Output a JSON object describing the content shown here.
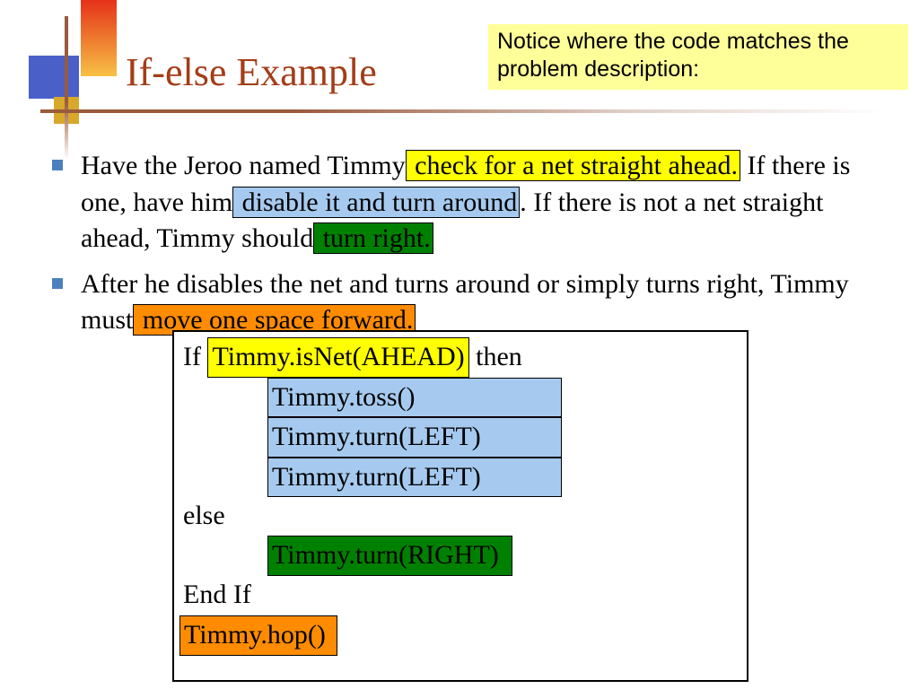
{
  "title": "If-else Example",
  "notice": "Notice where the code matches the problem description:",
  "bullets": {
    "b1": {
      "t1": "Have the Jeroo named Timmy",
      "y": " check for a net straight ahead.",
      "t2": " If there is one, have him",
      "b": " disable it and turn around",
      "t3": ". If there is not a net straight ahead, Timmy should",
      "g": " turn right."
    },
    "b2": {
      "t1": "After he disables the net and turns around or simply turns right, Timmy must",
      "o": " move one space forward."
    }
  },
  "code": {
    "l1a": "If ",
    "l1b": "Timmy.isNet(AHEAD)",
    "l1c": "  then",
    "l2": "Timmy.toss()",
    "l3": "Timmy.turn(LEFT)",
    "l4": "Timmy.turn(LEFT)",
    "l5": "else",
    "l6": "Timmy.turn(RIGHT)",
    "l7": "End If",
    "l8": "Timmy.hop()"
  }
}
